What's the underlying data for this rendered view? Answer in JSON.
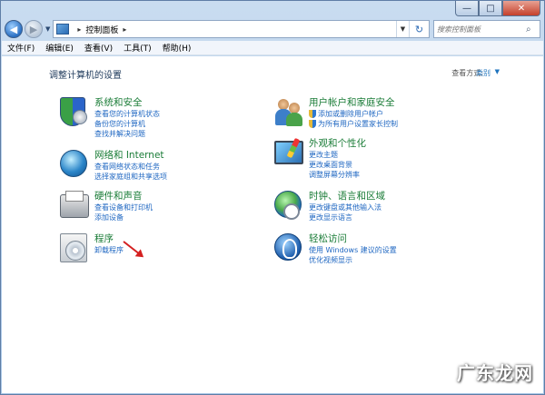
{
  "window": {
    "minimize": "—",
    "maximize": "□",
    "close": "✕"
  },
  "address": {
    "breadcrumb": "控制面板",
    "search_placeholder": "搜索控制面板"
  },
  "menu": [
    "文件(F)",
    "编辑(E)",
    "查看(V)",
    "工具(T)",
    "帮助(H)"
  ],
  "content": {
    "title": "调整计算机的设置",
    "view_by_label": "查看方式:",
    "view_by_value": "类别"
  },
  "categories": {
    "system": {
      "title": "系统和安全",
      "links": [
        "查看您的计算机状态",
        "备份您的计算机",
        "查找并解决问题"
      ]
    },
    "network": {
      "title": "网络和 Internet",
      "links": [
        "查看网络状态和任务",
        "选择家庭组和共享选项"
      ]
    },
    "hardware": {
      "title": "硬件和声音",
      "links": [
        "查看设备和打印机",
        "添加设备"
      ]
    },
    "programs": {
      "title": "程序",
      "links": [
        "卸载程序"
      ]
    },
    "users": {
      "title": "用户帐户和家庭安全",
      "links": [
        "添加或删除用户帐户",
        "为所有用户设置家长控制"
      ]
    },
    "appearance": {
      "title": "外观和个性化",
      "links": [
        "更改主题",
        "更改桌面背景",
        "调整屏幕分辨率"
      ]
    },
    "clock": {
      "title": "时钟、语言和区域",
      "links": [
        "更改键盘或其他输入法",
        "更改显示语言"
      ]
    },
    "access": {
      "title": "轻松访问",
      "links": [
        "使用 Windows 建议的设置",
        "优化视频显示"
      ]
    }
  },
  "watermark": "广东龙网"
}
